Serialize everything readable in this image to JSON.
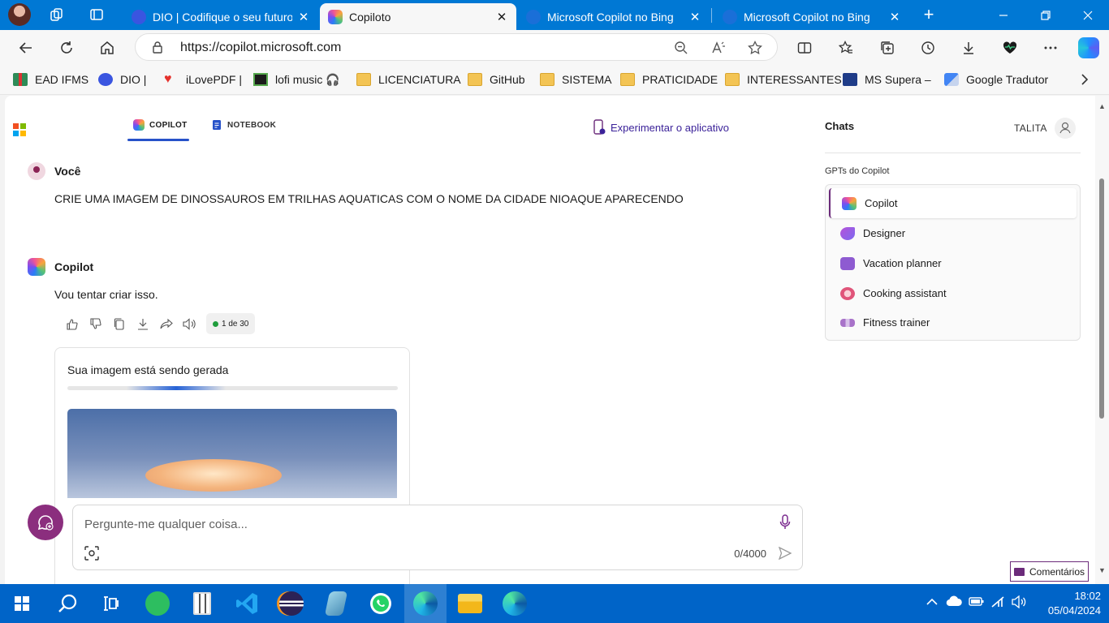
{
  "browser": {
    "tabs": [
      {
        "title": "DIO | Codifique o seu futuro",
        "active": false
      },
      {
        "title": "Copiloto",
        "active": true
      },
      {
        "title": "Microsoft Copilot no Bing",
        "active": false
      },
      {
        "title": "Microsoft Copilot no Bing",
        "active": false
      }
    ],
    "close_glyph": "✕",
    "new_tab_glyph": "+",
    "url": "https://copilot.microsoft.com",
    "bookmarks": [
      {
        "label": "EAD IFMS"
      },
      {
        "label": "DIO |"
      },
      {
        "label": "iLovePDF |"
      },
      {
        "label": "lofi music 🎧"
      },
      {
        "label": "LICENCIATURA"
      },
      {
        "label": "GitHub"
      },
      {
        "label": "SISTEMA"
      },
      {
        "label": "PRATICIDADE"
      },
      {
        "label": "INTERESSANTES"
      },
      {
        "label": "MS Supera –"
      },
      {
        "label": "Google Tradutor"
      }
    ]
  },
  "copilot": {
    "nav": {
      "tab_copilot": "COPILOT",
      "tab_notebook": "NOTEBOOK",
      "try_app": "Experimentar o aplicativo"
    },
    "conversation": {
      "user_name": "Você",
      "user_message": "CRIE UMA IMAGEM DE DINOSSAUROS EM TRILHAS AQUATICAS COM O NOME DA CIDADE NIOAQUE APARECENDO",
      "bot_name": "Copilot",
      "bot_message": "Vou tentar criar isso.",
      "turn_counter": "1 de 30",
      "generating_title": "Sua imagem está sendo gerada",
      "progress_fraction": 0.3
    },
    "input": {
      "placeholder": "Pergunte-me qualquer coisa...",
      "char_count": "0/4000"
    },
    "sidebar": {
      "chats_heading": "Chats",
      "user": "TALITA",
      "gpts_heading": "GPTs do Copilot",
      "gpts": [
        {
          "label": "Copilot",
          "color": "#7d4df0"
        },
        {
          "label": "Designer",
          "color": "#b552d9"
        },
        {
          "label": "Vacation planner",
          "color": "#8e5bd1"
        },
        {
          "label": "Cooking assistant",
          "color": "#e0557a"
        },
        {
          "label": "Fitness trainer",
          "color": "#a872c9"
        }
      ]
    },
    "feedback_label": "Comentários"
  },
  "taskbar": {
    "time": "18:02",
    "date": "05/04/2024"
  },
  "colors": {
    "browser_blue": "#0078d4",
    "taskbar_blue": "#0064c8",
    "copilot_purple": "#6b2b7a",
    "link_accent": "#2752c9"
  }
}
